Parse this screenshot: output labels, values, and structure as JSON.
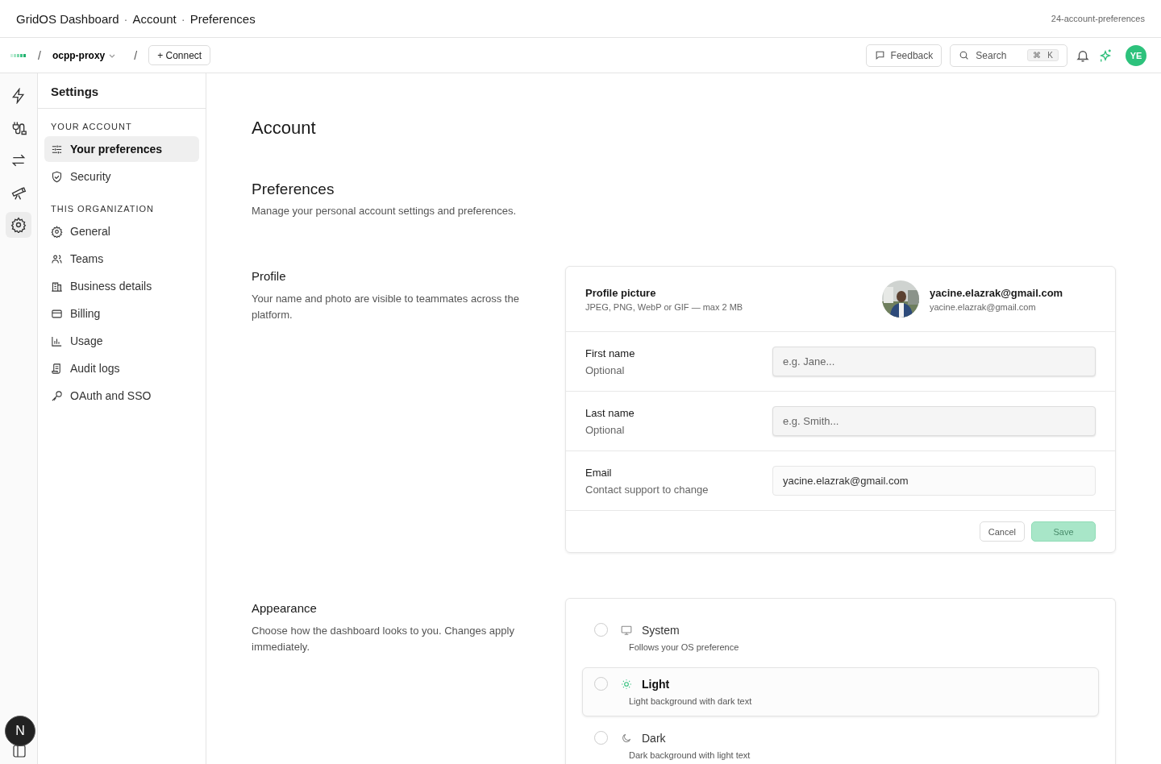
{
  "window": {
    "title_parts": [
      "GridOS Dashboard",
      "Account",
      "Preferences"
    ],
    "title_separator": "·",
    "tag": "24-account-preferences"
  },
  "toolbar": {
    "project": "ocpp-proxy",
    "separator": "/",
    "connect": "+ Connect",
    "feedback": "Feedback",
    "search": "Search",
    "shortcut": [
      "⌘",
      "K"
    ],
    "user_initials": "YE"
  },
  "rail": [
    {
      "selected": false
    },
    {
      "selected": false
    },
    {
      "selected": false
    },
    {
      "selected": false
    },
    {
      "selected": true
    }
  ],
  "rail_bottom": {
    "badge": "N"
  },
  "settings_nav": {
    "title": "Settings",
    "groups": [
      {
        "heading": "YOUR ACCOUNT",
        "items": [
          {
            "label": "Your preferences",
            "selected": true
          },
          {
            "label": "Security",
            "selected": false
          }
        ]
      },
      {
        "heading": "THIS ORGANIZATION",
        "items": [
          {
            "label": "General",
            "selected": false
          },
          {
            "label": "Teams",
            "selected": false
          },
          {
            "label": "Business details",
            "selected": false
          },
          {
            "label": "Billing",
            "selected": false
          },
          {
            "label": "Usage",
            "selected": false
          },
          {
            "label": "Audit logs",
            "selected": false
          },
          {
            "label": "OAuth and SSO",
            "selected": false
          }
        ]
      }
    ]
  },
  "page": {
    "title": "Account",
    "section_title": "Preferences",
    "section_description": "Manage your personal account settings and preferences."
  },
  "profile": {
    "title": "Profile",
    "description": "Your name and photo are visible to teammates across the platform.",
    "picture": {
      "label": "Profile picture",
      "hint": "JPEG, PNG, WebP or GIF — max 2 MB",
      "name": "yacine.elazrak@gmail.com",
      "email": "yacine.elazrak@gmail.com"
    },
    "fields": [
      {
        "label": "First name",
        "hint": "Optional",
        "placeholder": "e.g. Jane...",
        "disabled": false
      },
      {
        "label": "Last name",
        "hint": "Optional",
        "placeholder": "e.g. Smith...",
        "disabled": false
      },
      {
        "label": "Email",
        "hint": "Contact support to change",
        "value": "yacine.elazrak@gmail.com",
        "disabled": true
      }
    ],
    "cancel": "Cancel",
    "save": "Save",
    "save_disabled": true
  },
  "appearance": {
    "title": "Appearance",
    "description": "Choose how the dashboard looks to you. Changes apply immediately.",
    "options": [
      {
        "label": "System",
        "description": "Follows your OS preference",
        "selected": false
      },
      {
        "label": "Light",
        "description": "Light background with dark text",
        "selected": true
      },
      {
        "label": "Dark",
        "description": "Dark background with light text",
        "selected": false
      }
    ]
  }
}
